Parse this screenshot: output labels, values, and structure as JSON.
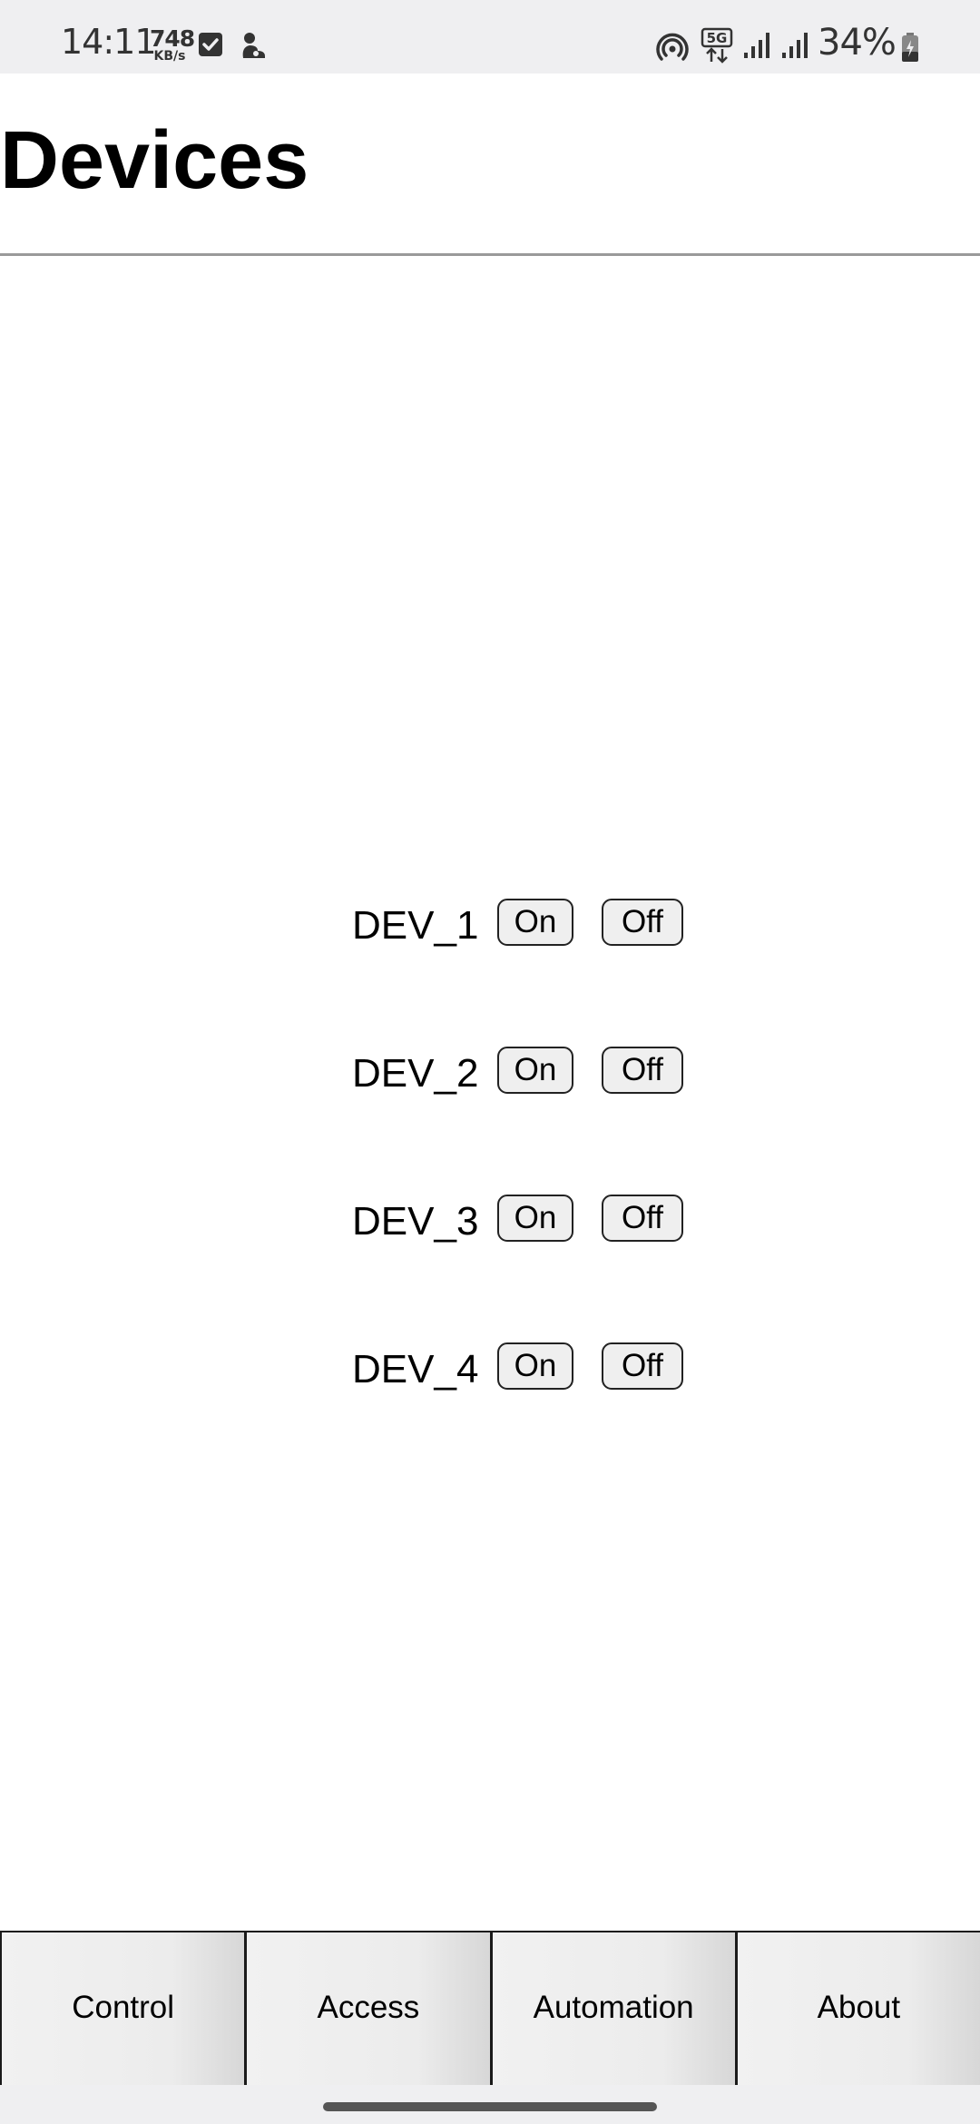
{
  "status_bar": {
    "time": "14:11",
    "speed_value": "748",
    "speed_unit": "KB/s",
    "battery_percent": "34%",
    "network_type": "5G",
    "left_icons": [
      "checkbox-icon",
      "app-notification-icon"
    ],
    "right_icons": [
      "hotspot-icon",
      "5g-data-icon",
      "signal-icon",
      "signal-icon",
      "battery-charging-icon"
    ]
  },
  "header": {
    "title": "Devices"
  },
  "devices": [
    {
      "name": "DEV_1",
      "on_label": "On",
      "off_label": "Off"
    },
    {
      "name": "DEV_2",
      "on_label": "On",
      "off_label": "Off"
    },
    {
      "name": "DEV_3",
      "on_label": "On",
      "off_label": "Off"
    },
    {
      "name": "DEV_4",
      "on_label": "On",
      "off_label": "Off"
    }
  ],
  "tabs": [
    {
      "label": "Control"
    },
    {
      "label": "Access"
    },
    {
      "label": "Automation"
    },
    {
      "label": "About"
    }
  ],
  "colors": {
    "status_bar_bg": "#efeff1",
    "button_bg": "#efefef",
    "tab_bg": "#ececec",
    "divider": "#9a9a9a"
  }
}
